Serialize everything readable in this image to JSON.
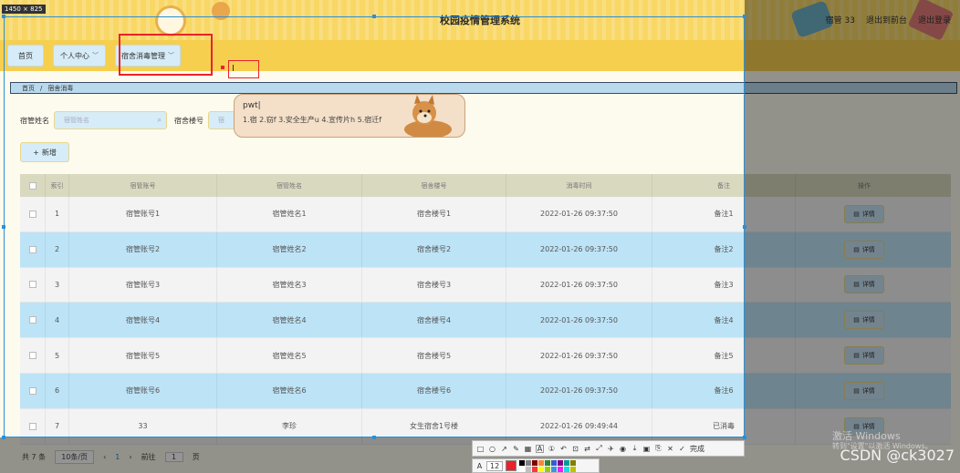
{
  "screenshot_size_label": "1450 × 825",
  "app_title": "校园疫情管理系统",
  "header_links": [
    "宿管 33",
    "退出到前台",
    "退出登录"
  ],
  "nav": {
    "home": "首页",
    "personal": "个人中心",
    "dorm": "宿舍消毒管理"
  },
  "breadcrumb": {
    "home": "首页",
    "sep": "/",
    "current": "宿舍消毒"
  },
  "search": {
    "label1": "宿管姓名",
    "placeholder1": "宿管姓名",
    "label2": "宿舍楼号",
    "placeholder2": "宿"
  },
  "add_button": "新增",
  "columns": [
    "索引",
    "宿管账号",
    "宿管姓名",
    "宿舍楼号",
    "消毒时间",
    "备注",
    "操作"
  ],
  "rows": [
    {
      "idx": "1",
      "account": "宿管账号1",
      "name": "宿管姓名1",
      "building": "宿舍楼号1",
      "time": "2022-01-26 09:37:50",
      "note": "备注1"
    },
    {
      "idx": "2",
      "account": "宿管账号2",
      "name": "宿管姓名2",
      "building": "宿舍楼号2",
      "time": "2022-01-26 09:37:50",
      "note": "备注2"
    },
    {
      "idx": "3",
      "account": "宿管账号3",
      "name": "宿管姓名3",
      "building": "宿舍楼号3",
      "time": "2022-01-26 09:37:50",
      "note": "备注3"
    },
    {
      "idx": "4",
      "account": "宿管账号4",
      "name": "宿管姓名4",
      "building": "宿舍楼号4",
      "time": "2022-01-26 09:37:50",
      "note": "备注4"
    },
    {
      "idx": "5",
      "account": "宿管账号5",
      "name": "宿管姓名5",
      "building": "宿舍楼号5",
      "time": "2022-01-26 09:37:50",
      "note": "备注5"
    },
    {
      "idx": "6",
      "account": "宿管账号6",
      "name": "宿管姓名6",
      "building": "宿舍楼号6",
      "time": "2022-01-26 09:37:50",
      "note": "备注6"
    },
    {
      "idx": "7",
      "account": "33",
      "name": "李珍",
      "building": "女生宿舍1号楼",
      "time": "2022-01-26 09:49:44",
      "note": "已消毒"
    }
  ],
  "detail_label": "详情",
  "pager": {
    "total": "共 7 条",
    "page_size": "10条/页",
    "current_page": "1",
    "goto": "前往",
    "goto_value": "1",
    "page_unit": "页"
  },
  "ime": {
    "typed": "pwt|",
    "candidates": "1.宿 2.窃f 3.安全生产u 4.宣传片h 5.宿迁f"
  },
  "shot_toolbar": {
    "finish": "完成",
    "font_size": "12"
  },
  "watermark": {
    "line1": "激活 Windows",
    "line2": "转到\"设置\"以激活 Windows。"
  },
  "csdn": "CSDN @ck3027",
  "colors": {
    "header": "#f8d765",
    "row_blue": "#bde3f6",
    "row_gray": "#f3f3f3",
    "annotation_red": "#e8232a",
    "selection_blue": "#2d8fd5"
  }
}
